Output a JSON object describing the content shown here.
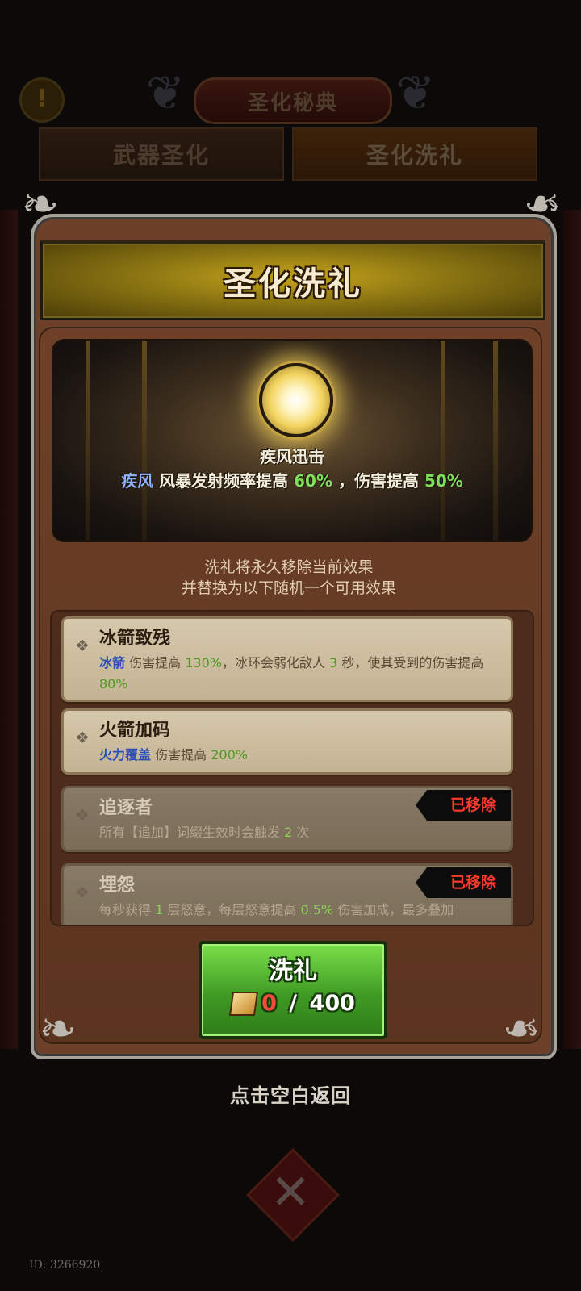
{
  "background": {
    "screen_title": "圣化秘典",
    "tabs": [
      {
        "label": "武器圣化",
        "active": false
      },
      {
        "label": "圣化洗礼",
        "active": true
      }
    ],
    "alert_icon": "exclamation-icon"
  },
  "panel": {
    "title": "圣化洗礼",
    "current_effect": {
      "name": "疾风迅击",
      "keyword": "疾风",
      "text_1": "风暴发射频率提高",
      "value_1": "60%",
      "text_2": "，伤害提高",
      "value_2": "50%"
    },
    "notice_line_1": "洗礼将永久移除当前效果",
    "notice_line_2": "并替换为以下随机一个可用效果",
    "options": [
      {
        "title": "冰箭致残",
        "removed": false,
        "keyword": "冰箭",
        "t1": " 伤害提高 ",
        "v1": "130%",
        "t2": "，冰环会弱化敌人 ",
        "v2": "3",
        "t3": " 秒，使其受到的伤害提高 ",
        "v3": "80%"
      },
      {
        "title": "火箭加码",
        "removed": false,
        "keyword": "火力覆盖",
        "t1": " 伤害提高 ",
        "v1": "200%"
      },
      {
        "title": "追逐者",
        "removed": true,
        "removed_label": "已移除",
        "t1": "所有【追加】词缀生效时会触发 ",
        "v1": "2",
        "t2": " 次"
      },
      {
        "title": "埋怨",
        "removed": true,
        "removed_label": "已移除",
        "t1": "每秒获得 ",
        "v1": "1",
        "t2": " 层怒意，每层怒意提高 ",
        "v2": "0.5%",
        "t3": " 伤害加成，最多叠加"
      }
    ],
    "button": {
      "label": "洗礼",
      "cost_have": "0",
      "cost_sep": " / ",
      "cost_need": "400",
      "cost_icon": "scroll-currency-icon"
    }
  },
  "footer": {
    "tap_return": "点击空白返回",
    "build_id": "ID: 3266920"
  },
  "colors": {
    "keyword": "#8fb0ff",
    "value": "#7ee05a",
    "removed": "#ff3b2f",
    "button_green": "#3f9b24"
  }
}
